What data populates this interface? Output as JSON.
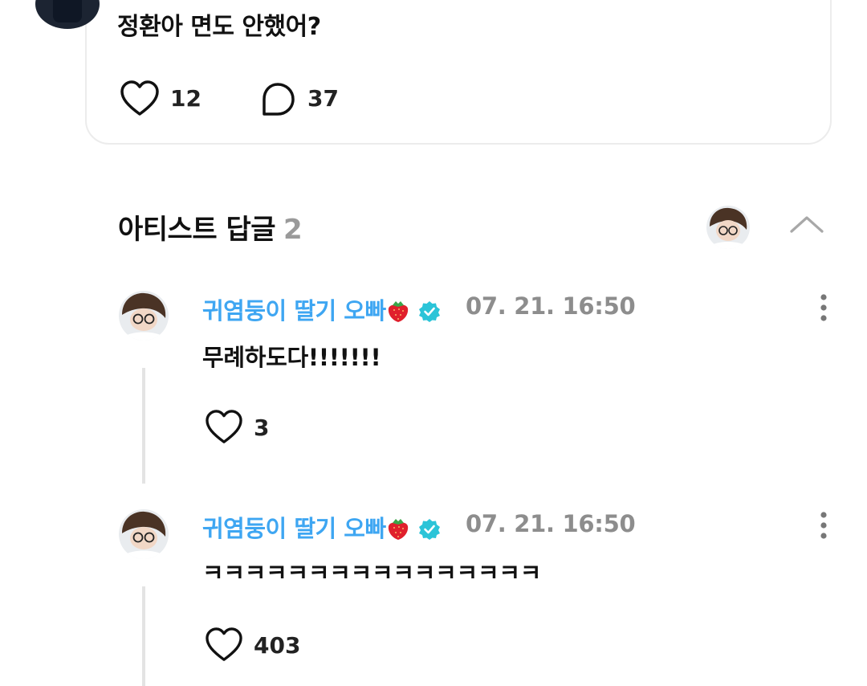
{
  "post": {
    "text": "정환아 면도 안했어?",
    "likes": "12",
    "comments": "37"
  },
  "section": {
    "title": "아티스트 답글",
    "count": "2"
  },
  "replies": [
    {
      "author": "귀염둥이 딸기 오빠",
      "time": "07. 21. 16:50",
      "text": "무례하도다!!!!!!!",
      "likes": "3"
    },
    {
      "author": "귀염둥이 딸기 오빠",
      "time": "07. 21. 16:50",
      "text": "ㅋㅋㅋㅋㅋㅋㅋㅋㅋㅋㅋㅋㅋㅋㅋㅋ",
      "likes": "403"
    }
  ],
  "colors": {
    "author": "#3ea6f2",
    "verified": "#2bc4d8",
    "muted": "#8d8d8d"
  },
  "icons": [
    "heart-icon",
    "comment-bubble-icon",
    "chevron-up-icon",
    "more-vertical-icon",
    "verified-badge-icon",
    "strawberry-icon"
  ]
}
